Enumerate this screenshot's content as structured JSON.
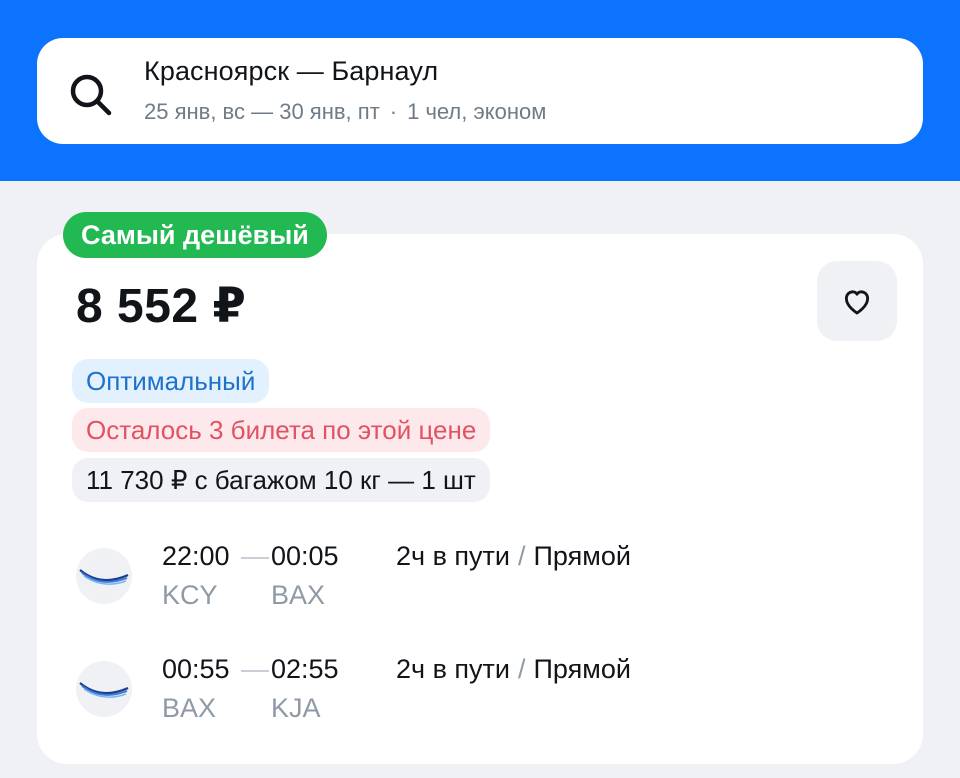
{
  "search": {
    "route": "Красноярск — Барнаул",
    "dates": "25 янв, вс — 30 янв, пт",
    "separator": "·",
    "passengers": "1 чел, эконом"
  },
  "offer": {
    "badge": "Самый дешёвый",
    "price": "8 552 ₽",
    "tags": {
      "optimal": "Оптимальный",
      "seats_left": "Осталось 3 билета по этой цене",
      "baggage": "11 730 ₽ с багажом 10 кг — 1 шт"
    },
    "segments": [
      {
        "dep_time": "22:00",
        "arr_time": "00:05",
        "dep_code": "KCY",
        "arr_code": "BAX",
        "duration": "2ч в пути",
        "slash": "/",
        "type": "Прямой"
      },
      {
        "dep_time": "00:55",
        "arr_time": "02:55",
        "dep_code": "BAX",
        "arr_code": "KJA",
        "duration": "2ч в пути",
        "slash": "/",
        "type": "Прямой"
      }
    ]
  },
  "icons": {
    "search": "search-icon",
    "favorite": "heart-icon",
    "airline": "airline-logo"
  },
  "colors": {
    "brand": "#0c73fe",
    "badge_green": "#22b953",
    "optimal_blue": "#1e73c9",
    "warning_red": "#e15262"
  }
}
